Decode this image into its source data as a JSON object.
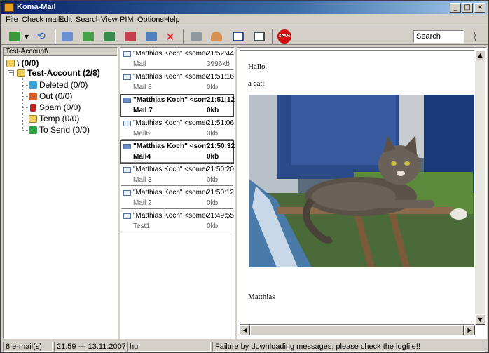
{
  "window": {
    "title": "Koma-Mail"
  },
  "window_buttons": {
    "minimize": "_",
    "maximize": "□",
    "close": "×"
  },
  "menu": [
    "File",
    "Check mails",
    "Edit",
    "Search",
    "View",
    "PIM",
    "Options",
    "Help"
  ],
  "toolbar": {
    "search_value": "Search",
    "icons": [
      "download-icon",
      "dropdown-arrow-icon",
      "sync-icon",
      "write-mail-icon",
      "reply-icon",
      "reply-all-icon",
      "forward-icon",
      "send-icon",
      "delete-icon",
      "print-icon",
      "contacts-icon",
      "calendar-icon",
      "notes-icon",
      "spam-icon",
      "attachment-icon"
    ],
    "spam_label": "SPAM",
    "colors": {
      "delete": "#e02020",
      "spam": "#cc1010",
      "green": "#3a9a3a",
      "blue": "#2a60c0"
    }
  },
  "folders": {
    "header": "Test-Account\\",
    "root": {
      "label": "\\ (0/0)"
    },
    "account": {
      "label": "Test-Account (2/8)"
    },
    "items": [
      {
        "label": "Deleted (0/0)",
        "icon": "recycle-icon",
        "color": "#40a0d0"
      },
      {
        "label": "Out (0/0)",
        "icon": "outbox-icon",
        "color": "#d06030"
      },
      {
        "label": "Spam (0/0)",
        "icon": "spam-can-icon",
        "color": "#c02020"
      },
      {
        "label": "Temp (0/0)",
        "icon": "folder-icon",
        "color": "#f0d060"
      },
      {
        "label": "To Send (0/0)",
        "icon": "tosend-icon",
        "color": "#30a040"
      }
    ]
  },
  "mails": [
    {
      "from": "\"Matthias Koch\" <someo...",
      "time": "21:52:44",
      "subject": "Mail",
      "size": "3996kb",
      "unread": false,
      "attachment": true
    },
    {
      "from": "\"Matthias Koch\" <someo...",
      "time": "21:51:16",
      "subject": "Mail 8",
      "size": "0kb",
      "unread": false,
      "attachment": false
    },
    {
      "from": "\"Matthias Koch\" <som...",
      "time": "21:51:12",
      "subject": "Mail 7",
      "size": "0kb",
      "unread": true,
      "attachment": false
    },
    {
      "from": "\"Matthias Koch\" <someo...",
      "time": "21:51:06",
      "subject": "Mail6",
      "size": "0kb",
      "unread": false,
      "attachment": false
    },
    {
      "from": "\"Matthias Koch\" <som...",
      "time": "21:50:32",
      "subject": "Mail4",
      "size": "0kb",
      "unread": true,
      "attachment": false
    },
    {
      "from": "\"Matthias Koch\" <someo...",
      "time": "21:50:20",
      "subject": "Mail 3",
      "size": "0kb",
      "unread": false,
      "attachment": false
    },
    {
      "from": "\"Matthias Koch\" <someo...",
      "time": "21:50:12",
      "subject": "Mail 2",
      "size": "0kb",
      "unread": false,
      "attachment": false
    },
    {
      "from": "\"Matthias Koch\" <someo...",
      "time": "21:49:55",
      "subject": "Test1",
      "size": "0kb",
      "unread": false,
      "attachment": false
    }
  ],
  "preview": {
    "greeting": "Hallo,",
    "intro": "a cat:",
    "signature": "Matthias",
    "image": "cat-photo"
  },
  "statusbar": {
    "count": "8 e-mail(s)",
    "datetime": "21:59 --- 13.11.2007",
    "lang": "hu",
    "message": "Failure by downloading messages, please check the logfile!!"
  }
}
